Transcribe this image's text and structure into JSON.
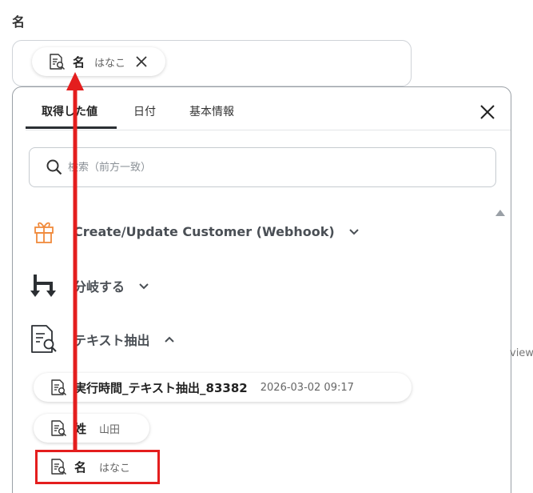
{
  "field": {
    "label": "名",
    "chip": {
      "name": "名",
      "value": "はなこ"
    }
  },
  "panel": {
    "tabs": [
      {
        "label": "取得した値",
        "active": true
      },
      {
        "label": "日付",
        "active": false
      },
      {
        "label": "基本情報",
        "active": false
      }
    ],
    "search_placeholder": "検索（前方一致）",
    "groups": [
      {
        "title": "Create/Update Customer (Webhook)",
        "icon": "gift-icon",
        "expanded": false
      },
      {
        "title": "分岐する",
        "icon": "branch-icon",
        "expanded": false
      },
      {
        "title": "テキスト抽出",
        "icon": "document-search-icon",
        "expanded": true
      }
    ],
    "items": [
      {
        "name": "実行時間_テキスト抽出_83382",
        "value": "2026-03-02 09:17"
      },
      {
        "name": "姓",
        "value": "山田"
      },
      {
        "name": "名",
        "value": "はなこ"
      }
    ]
  },
  "fragment_text": "view",
  "colors": {
    "accent_red": "#e41e1e",
    "gift_orange": "#f08a3c",
    "text_dark": "#2b2f33"
  }
}
